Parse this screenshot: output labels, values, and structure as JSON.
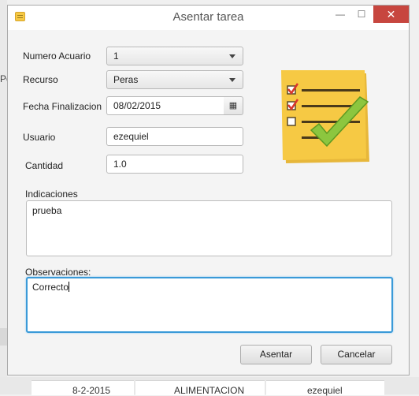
{
  "window": {
    "title": "Asentar tarea",
    "min_glyph": "—",
    "max_glyph": "☐",
    "close_glyph": "✕"
  },
  "background": {
    "tab_fragment": "Pe",
    "row": {
      "date": "8-2-2015",
      "category": "ALIMENTACION",
      "user": "ezequiel"
    }
  },
  "form": {
    "numero_acuario": {
      "label": "Numero Acuario",
      "value": "1"
    },
    "recurso": {
      "label": "Recurso",
      "value": "Peras"
    },
    "fecha_finalizacion": {
      "label": "Fecha Finalizacion",
      "value": "08/02/2015",
      "button_icon": "▦"
    },
    "usuario": {
      "label": "Usuario",
      "value": "ezequiel"
    },
    "cantidad": {
      "label": "Cantidad",
      "value": "1.0"
    },
    "indicaciones": {
      "label": "Indicaciones",
      "value": "prueba"
    },
    "observaciones": {
      "label": "Observaciones:",
      "value": "Correcto"
    }
  },
  "buttons": {
    "asentar": "Asentar",
    "cancelar": "Cancelar"
  },
  "colors": {
    "accent_focus": "#3a9ad8",
    "close_red": "#c7463f",
    "note_yellow": "#f6c944",
    "check_green": "#8cc63f"
  },
  "icons": {
    "illustration": "task-checklist-icon",
    "app": "note-icon",
    "calendar": "calendar-icon"
  }
}
